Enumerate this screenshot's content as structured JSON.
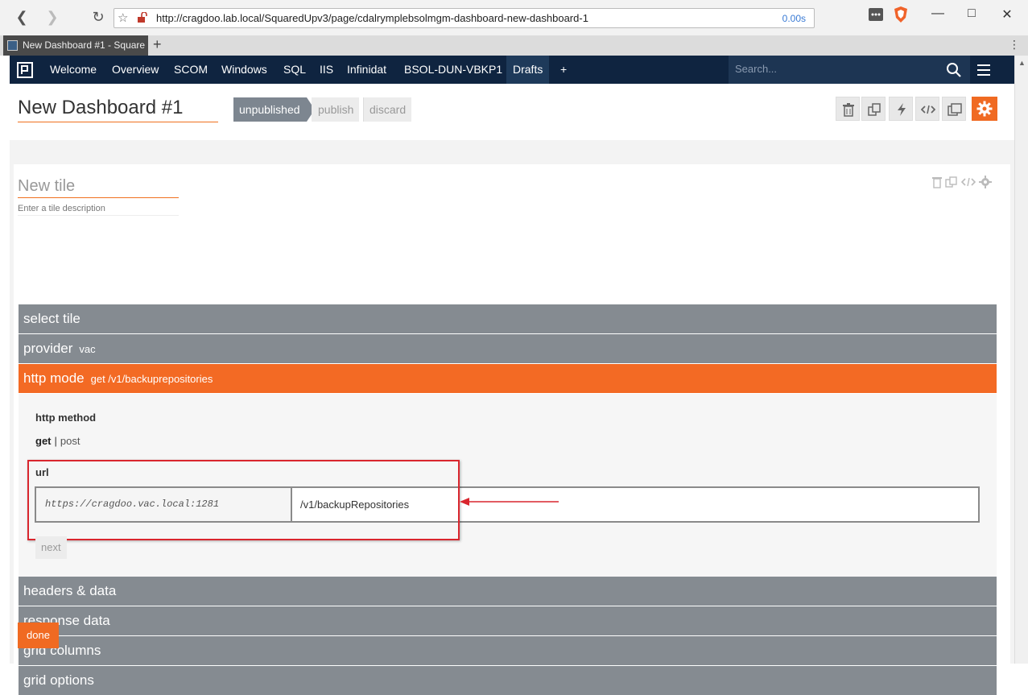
{
  "browser": {
    "url": "http://cragdoo.lab.local/SquaredUpv3/page/cdalrymplebsolmgm-dashboard-new-dashboard-1",
    "timing": "0.00s",
    "tab_title": "New Dashboard #1 - Square",
    "new_tab_symbol": "+"
  },
  "nav": {
    "items": [
      "Welcome",
      "Overview",
      "SCOM",
      "Windows",
      "SQL",
      "IIS",
      "Infinidat",
      "BSOL-DUN-VBKP1",
      "Drafts",
      "+"
    ],
    "search_placeholder": "Search..."
  },
  "header": {
    "title": "New Dashboard #1",
    "status": "unpublished",
    "publish": "publish",
    "discard": "discard"
  },
  "tile": {
    "title_placeholder": "New tile",
    "description_placeholder": "Enter a tile description",
    "sections": {
      "select_tile": "select tile",
      "provider": "provider",
      "provider_value": "vac",
      "http_mode": "http mode",
      "http_mode_value": "get /v1/backuprepositories",
      "headers_data": "headers & data",
      "response_data": "response data",
      "grid_columns": "grid columns",
      "grid_options": "grid options"
    },
    "http_method_label": "http method",
    "method_get": "get",
    "method_sep": "|",
    "method_post": "post",
    "url_label": "url",
    "url_base": "https://cragdoo.vac.local:1281",
    "url_path": "/v1/backupRepositories",
    "next": "next",
    "done": "done"
  },
  "colors": {
    "accent": "#f06a22",
    "nav_bg": "#0f2440",
    "section_bg": "#858b91",
    "annotation": "#d9262e"
  }
}
